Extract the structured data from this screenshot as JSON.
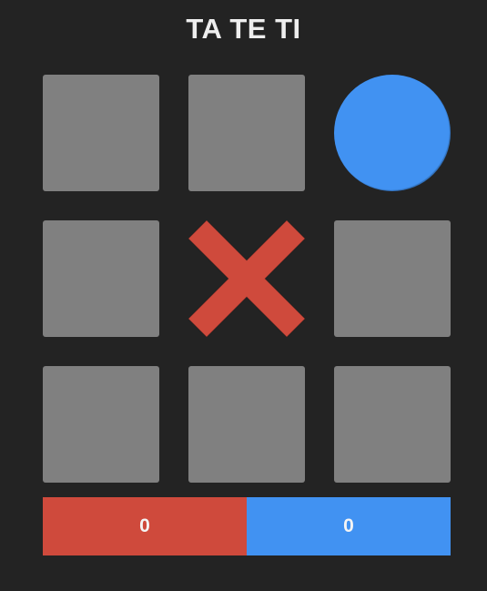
{
  "title": "TA TE TI",
  "colors": {
    "background": "#232323",
    "empty_cell": "#808080",
    "x": "#cf4a3c",
    "o": "#4192f2"
  },
  "board": {
    "cells": [
      "",
      "",
      "O",
      "",
      "X",
      "",
      "",
      "",
      ""
    ]
  },
  "score": {
    "x": "0",
    "o": "0"
  }
}
